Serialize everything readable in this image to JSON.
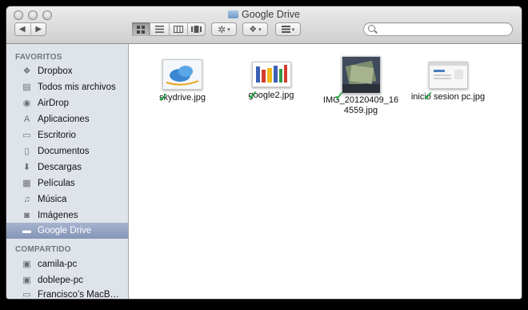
{
  "window": {
    "title": "Google Drive"
  },
  "toolbar": {
    "nav_back_icon": "triangle-left-icon",
    "nav_forward_icon": "triangle-right-icon",
    "view_modes": [
      "icon-view-icon",
      "list-view-icon",
      "column-view-icon",
      "coverflow-view-icon"
    ],
    "action_icon": "gear-icon",
    "share_icon": "dropbox-icon",
    "arrange_icon": "arrange-icon",
    "search_placeholder": ""
  },
  "sidebar": {
    "favorites_heading": "FAVORITOS",
    "favorites": [
      {
        "label": "Dropbox",
        "icon": "dropbox-icon"
      },
      {
        "label": "Todos mis archivos",
        "icon": "all-files-icon"
      },
      {
        "label": "AirDrop",
        "icon": "airdrop-icon"
      },
      {
        "label": "Aplicaciones",
        "icon": "applications-icon"
      },
      {
        "label": "Escritorio",
        "icon": "desktop-icon"
      },
      {
        "label": "Documentos",
        "icon": "documents-icon"
      },
      {
        "label": "Descargas",
        "icon": "downloads-icon"
      },
      {
        "label": "Películas",
        "icon": "movies-icon"
      },
      {
        "label": "Música",
        "icon": "music-icon"
      },
      {
        "label": "Imágenes",
        "icon": "pictures-icon"
      },
      {
        "label": "Google Drive",
        "icon": "folder-icon",
        "selected": true
      }
    ],
    "shared_heading": "COMPARTIDO",
    "shared": [
      {
        "label": "camila-pc",
        "icon": "computer-icon"
      },
      {
        "label": "doblepe-pc",
        "icon": "computer-icon"
      },
      {
        "label": "Francisco’s MacB…",
        "icon": "laptop-icon"
      }
    ]
  },
  "files": [
    {
      "name": "skydrive.jpg",
      "synced": true,
      "icon": "skydrive-thumbnail"
    },
    {
      "name": "google2.jpg",
      "synced": true,
      "icon": "google-logo-thumbnail"
    },
    {
      "name": "IMG_20120409_164559.jpg",
      "name_line1": "IMG_20120409_16",
      "name_line2": "4559.jpg",
      "synced": true,
      "icon": "photo-thumbnail"
    },
    {
      "name": "inicio sesion pc.jpg",
      "synced": true,
      "icon": "screenshot-thumbnail"
    }
  ],
  "colors": {
    "selection": "#8495b7",
    "sync_check": "#29a84a",
    "sidebar_bg": "#dfe4ea"
  }
}
